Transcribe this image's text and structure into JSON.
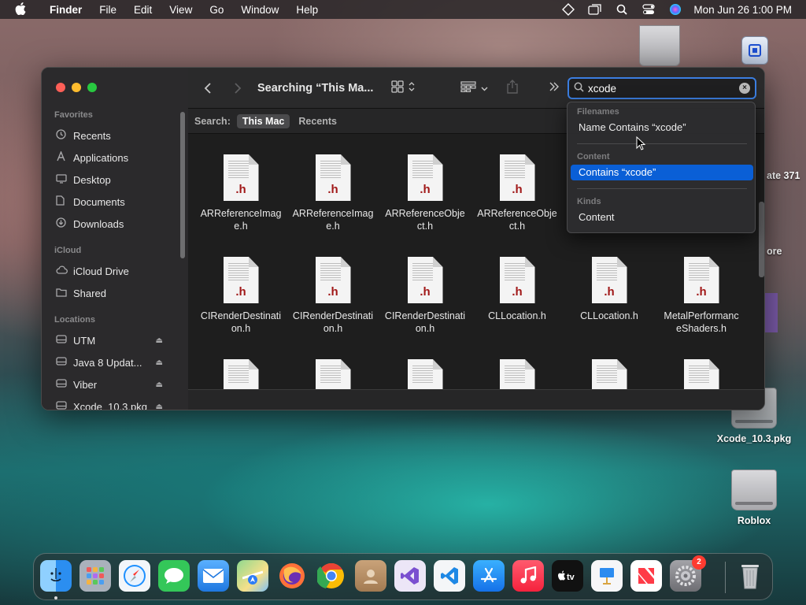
{
  "menubar": {
    "app_name": "Finder",
    "items": [
      "File",
      "Edit",
      "View",
      "Go",
      "Window",
      "Help"
    ],
    "clock": "Mon Jun 26  1:00 PM"
  },
  "desktop": {
    "items": [
      {
        "label": "Xcode_10.3.pkg"
      },
      {
        "label": "Roblox"
      }
    ],
    "partial_labels": [
      "ate 371",
      "ore"
    ]
  },
  "finder": {
    "toolbar": {
      "title": "Searching “This Ma...",
      "search_value": "xcode"
    },
    "sidebar": {
      "favorites_header": "Favorites",
      "favorites": [
        {
          "label": "Recents",
          "icon": "clock-icon"
        },
        {
          "label": "Applications",
          "icon": "applications-icon"
        },
        {
          "label": "Desktop",
          "icon": "desktop-icon"
        },
        {
          "label": "Documents",
          "icon": "document-icon"
        },
        {
          "label": "Downloads",
          "icon": "download-icon"
        }
      ],
      "icloud_header": "iCloud",
      "icloud": [
        {
          "label": "iCloud Drive",
          "icon": "cloud-icon"
        },
        {
          "label": "Shared",
          "icon": "shared-folder-icon"
        }
      ],
      "locations_header": "Locations",
      "locations": [
        {
          "label": "UTM",
          "icon": "drive-icon"
        },
        {
          "label": "Java 8 Updat...",
          "icon": "drive-icon"
        },
        {
          "label": "Viber",
          "icon": "drive-icon"
        },
        {
          "label": "Xcode_10.3.pkg",
          "icon": "drive-icon"
        }
      ]
    },
    "scope": {
      "label": "Search:",
      "options": [
        "This Mac",
        "Recents"
      ],
      "selected": "This Mac"
    },
    "files": [
      {
        "name_1": "ARReferenceImag",
        "name_2": "e.h",
        "ext": ".h"
      },
      {
        "name_1": "ARReferenceImag",
        "name_2": "e.h",
        "ext": ".h"
      },
      {
        "name_1": "ARReferenceObje",
        "name_2": "ct.h",
        "ext": ".h"
      },
      {
        "name_1": "ARReferenceObje",
        "name_2": "ct.h",
        "ext": ".h"
      },
      {
        "name_1": "CIRenderDestinati",
        "name_2": "on.h",
        "ext": ".h"
      },
      {
        "name_1": "CIRenderDestinati",
        "name_2": "on.h",
        "ext": ".h"
      },
      {
        "name_1": "CIRenderDestinati",
        "name_2": "on.h",
        "ext": ".h"
      },
      {
        "name_1": "CLLocation.h",
        "name_2": "",
        "ext": ".h"
      },
      {
        "name_1": "CLLocation.h",
        "name_2": "",
        "ext": ".h"
      },
      {
        "name_1": "MetalPerformanc",
        "name_2": "eShaders.h",
        "ext": ".h"
      }
    ],
    "dropdown": {
      "sections": [
        {
          "header": "Filenames",
          "item": "Name Contains “xcode”"
        },
        {
          "header": "Content",
          "item": "Contains “xcode”"
        },
        {
          "header": "Kinds",
          "item": "Content"
        }
      ],
      "selected_index": 1
    }
  },
  "dock": {
    "badge_count": "2",
    "apps": [
      {
        "name": "finder",
        "color": "#2b8ef0"
      },
      {
        "name": "launchpad",
        "color": "#9aa0a8"
      },
      {
        "name": "safari",
        "color": "#f3f6fa"
      },
      {
        "name": "messages",
        "color": "#34c759"
      },
      {
        "name": "mail",
        "color": "#2d8cf0"
      },
      {
        "name": "maps",
        "color": "#6ec16e"
      },
      {
        "name": "firefox",
        "color": "#6b2fb3"
      },
      {
        "name": "chrome",
        "color": "#ffffff"
      },
      {
        "name": "contacts",
        "color": "#b08a5a"
      },
      {
        "name": "visual-studio",
        "color": "#e8e2f5"
      },
      {
        "name": "vscode",
        "color": "#f4f6f8"
      },
      {
        "name": "app-store",
        "color": "#1a8cf5"
      },
      {
        "name": "music",
        "color": "#fa2d48"
      },
      {
        "name": "apple-tv",
        "color": "#111111"
      },
      {
        "name": "keynote",
        "color": "#f6f6f8"
      },
      {
        "name": "news",
        "color": "#ffffff"
      },
      {
        "name": "system-settings",
        "color": "#8e8e93"
      },
      {
        "name": "trash",
        "color": "#bfc3c6"
      }
    ]
  },
  "colors": {
    "accent": "#0a5fd6",
    "focus_ring": "#3b7ee0",
    "file_ext": "#a11818"
  }
}
